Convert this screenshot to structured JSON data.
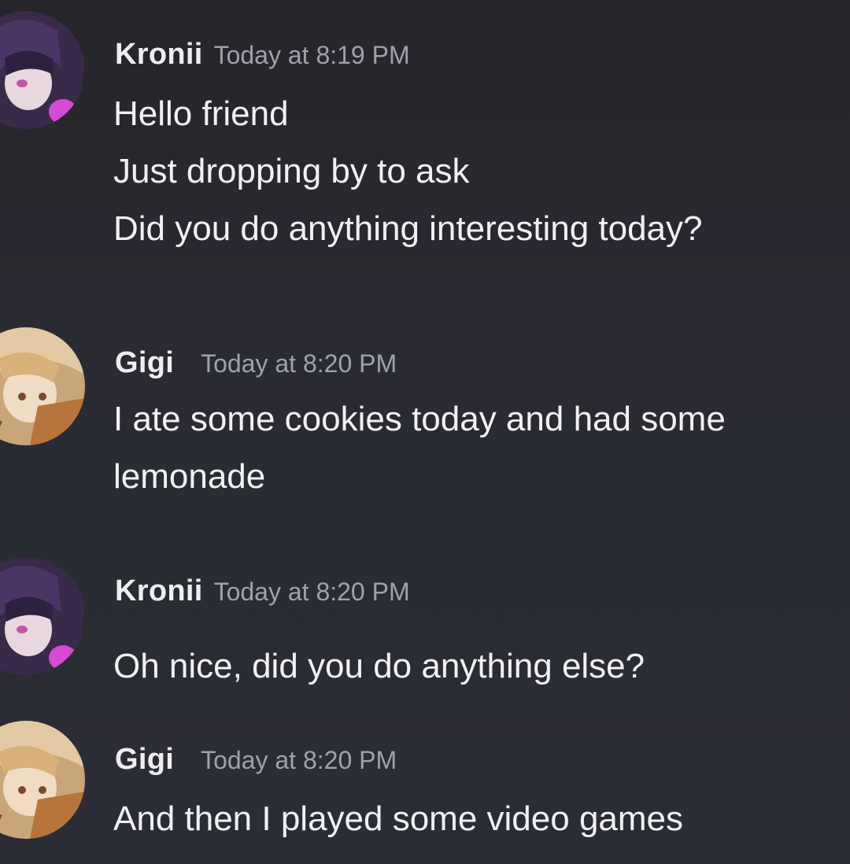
{
  "messages": [
    {
      "author": "Kronii",
      "timestamp": "Today at 8:19 PM",
      "avatar_icon": "kronii-avatar-icon",
      "lines": [
        "Hello friend",
        "Just dropping by to ask",
        "Did you do anything interesting today?"
      ]
    },
    {
      "author": "Gigi",
      "timestamp": "Today at 8:20 PM",
      "avatar_icon": "gigi-avatar-icon",
      "lines": [
        "I ate some cookies today and had some",
        "lemonade"
      ]
    },
    {
      "author": "Kronii",
      "timestamp": "Today at 8:20 PM",
      "avatar_icon": "kronii-avatar-icon",
      "lines": [
        "Oh nice, did you do anything else?"
      ]
    },
    {
      "author": "Gigi",
      "timestamp": "Today at 8:20 PM",
      "avatar_icon": "gigi-avatar-icon",
      "lines": [
        "And then I played some video games"
      ]
    }
  ],
  "colors": {
    "background": "#2b2c33",
    "username": "#eeeef0",
    "timestamp": "#9fa2aa",
    "message_text": "#f1f1f3"
  }
}
